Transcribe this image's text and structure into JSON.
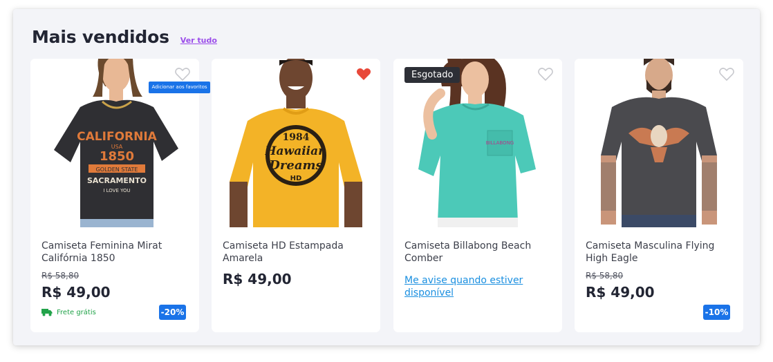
{
  "section": {
    "title": "Mais vendidos",
    "see_all": "Ver tudo"
  },
  "tooltip": "Adicionar aos favoritos",
  "colors": {
    "accent_blue": "#1a73e8",
    "link_purple": "#9b4dea",
    "heart_red": "#e8493a",
    "free_shipping_green": "#22a34a"
  },
  "products": [
    {
      "name": "Camiseta Feminina Mirat Califórnia 1850",
      "old_price": "R$ 58,80",
      "price": "R$ 49,00",
      "shipping": "Frete grátis",
      "discount": "-20%",
      "favorite": false
    },
    {
      "name": "Camiseta HD Estampada Amarela",
      "price": "R$ 49,00",
      "favorite": true
    },
    {
      "name": "Camiseta Billabong Beach Comber",
      "badge": "Esgotado",
      "notify": "Me avise quando estiver disponível",
      "favorite": false
    },
    {
      "name": "Camiseta Masculina Flying High Eagle",
      "old_price": "R$ 58,80",
      "price": "R$ 49,00",
      "discount": "-10%",
      "favorite": false
    }
  ],
  "icons": {
    "favorite": "heart-icon",
    "shipping": "truck-icon"
  }
}
